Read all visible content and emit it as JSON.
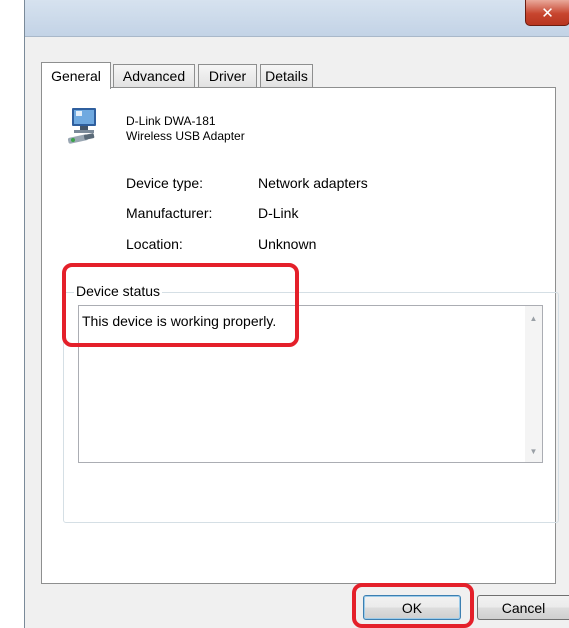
{
  "window": {
    "close_symbol": "✕"
  },
  "tabs": [
    {
      "label": "General",
      "active": true
    },
    {
      "label": "Advanced",
      "active": false
    },
    {
      "label": "Driver",
      "active": false
    },
    {
      "label": "Details",
      "active": false
    }
  ],
  "device": {
    "icon": "network-adapter-icon",
    "name_line1": "D-Link DWA-181",
    "name_line2": "Wireless USB Adapter"
  },
  "properties": [
    {
      "label": "Device type:",
      "value": "Network adapters"
    },
    {
      "label": "Manufacturer:",
      "value": "D-Link"
    },
    {
      "label": "Location:",
      "value": "Unknown"
    }
  ],
  "status": {
    "legend": "Device status",
    "text": "This device is working properly."
  },
  "buttons": {
    "ok": "OK",
    "cancel": "Cancel"
  },
  "colors": {
    "highlight": "#e4202a",
    "close_button": "#c7452e"
  }
}
